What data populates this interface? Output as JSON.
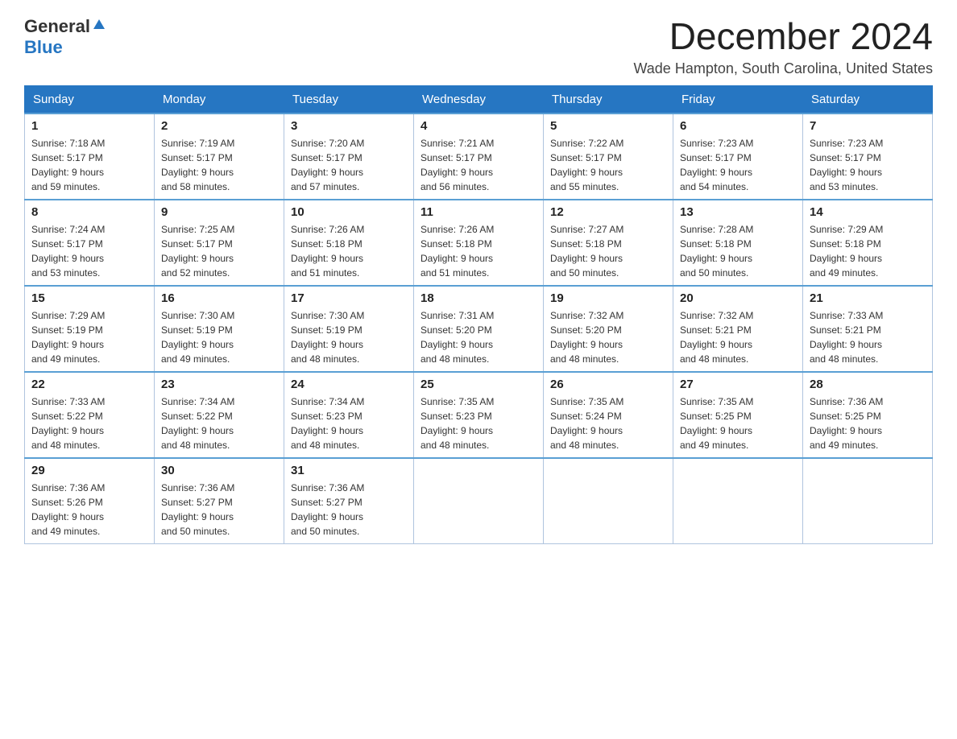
{
  "logo": {
    "general": "General",
    "blue": "Blue"
  },
  "title": "December 2024",
  "subtitle": "Wade Hampton, South Carolina, United States",
  "days_of_week": [
    "Sunday",
    "Monday",
    "Tuesday",
    "Wednesday",
    "Thursday",
    "Friday",
    "Saturday"
  ],
  "weeks": [
    [
      {
        "day": "1",
        "sunrise": "7:18 AM",
        "sunset": "5:17 PM",
        "daylight": "9 hours and 59 minutes."
      },
      {
        "day": "2",
        "sunrise": "7:19 AM",
        "sunset": "5:17 PM",
        "daylight": "9 hours and 58 minutes."
      },
      {
        "day": "3",
        "sunrise": "7:20 AM",
        "sunset": "5:17 PM",
        "daylight": "9 hours and 57 minutes."
      },
      {
        "day": "4",
        "sunrise": "7:21 AM",
        "sunset": "5:17 PM",
        "daylight": "9 hours and 56 minutes."
      },
      {
        "day": "5",
        "sunrise": "7:22 AM",
        "sunset": "5:17 PM",
        "daylight": "9 hours and 55 minutes."
      },
      {
        "day": "6",
        "sunrise": "7:23 AM",
        "sunset": "5:17 PM",
        "daylight": "9 hours and 54 minutes."
      },
      {
        "day": "7",
        "sunrise": "7:23 AM",
        "sunset": "5:17 PM",
        "daylight": "9 hours and 53 minutes."
      }
    ],
    [
      {
        "day": "8",
        "sunrise": "7:24 AM",
        "sunset": "5:17 PM",
        "daylight": "9 hours and 53 minutes."
      },
      {
        "day": "9",
        "sunrise": "7:25 AM",
        "sunset": "5:17 PM",
        "daylight": "9 hours and 52 minutes."
      },
      {
        "day": "10",
        "sunrise": "7:26 AM",
        "sunset": "5:18 PM",
        "daylight": "9 hours and 51 minutes."
      },
      {
        "day": "11",
        "sunrise": "7:26 AM",
        "sunset": "5:18 PM",
        "daylight": "9 hours and 51 minutes."
      },
      {
        "day": "12",
        "sunrise": "7:27 AM",
        "sunset": "5:18 PM",
        "daylight": "9 hours and 50 minutes."
      },
      {
        "day": "13",
        "sunrise": "7:28 AM",
        "sunset": "5:18 PM",
        "daylight": "9 hours and 50 minutes."
      },
      {
        "day": "14",
        "sunrise": "7:29 AM",
        "sunset": "5:18 PM",
        "daylight": "9 hours and 49 minutes."
      }
    ],
    [
      {
        "day": "15",
        "sunrise": "7:29 AM",
        "sunset": "5:19 PM",
        "daylight": "9 hours and 49 minutes."
      },
      {
        "day": "16",
        "sunrise": "7:30 AM",
        "sunset": "5:19 PM",
        "daylight": "9 hours and 49 minutes."
      },
      {
        "day": "17",
        "sunrise": "7:30 AM",
        "sunset": "5:19 PM",
        "daylight": "9 hours and 48 minutes."
      },
      {
        "day": "18",
        "sunrise": "7:31 AM",
        "sunset": "5:20 PM",
        "daylight": "9 hours and 48 minutes."
      },
      {
        "day": "19",
        "sunrise": "7:32 AM",
        "sunset": "5:20 PM",
        "daylight": "9 hours and 48 minutes."
      },
      {
        "day": "20",
        "sunrise": "7:32 AM",
        "sunset": "5:21 PM",
        "daylight": "9 hours and 48 minutes."
      },
      {
        "day": "21",
        "sunrise": "7:33 AM",
        "sunset": "5:21 PM",
        "daylight": "9 hours and 48 minutes."
      }
    ],
    [
      {
        "day": "22",
        "sunrise": "7:33 AM",
        "sunset": "5:22 PM",
        "daylight": "9 hours and 48 minutes."
      },
      {
        "day": "23",
        "sunrise": "7:34 AM",
        "sunset": "5:22 PM",
        "daylight": "9 hours and 48 minutes."
      },
      {
        "day": "24",
        "sunrise": "7:34 AM",
        "sunset": "5:23 PM",
        "daylight": "9 hours and 48 minutes."
      },
      {
        "day": "25",
        "sunrise": "7:35 AM",
        "sunset": "5:23 PM",
        "daylight": "9 hours and 48 minutes."
      },
      {
        "day": "26",
        "sunrise": "7:35 AM",
        "sunset": "5:24 PM",
        "daylight": "9 hours and 48 minutes."
      },
      {
        "day": "27",
        "sunrise": "7:35 AM",
        "sunset": "5:25 PM",
        "daylight": "9 hours and 49 minutes."
      },
      {
        "day": "28",
        "sunrise": "7:36 AM",
        "sunset": "5:25 PM",
        "daylight": "9 hours and 49 minutes."
      }
    ],
    [
      {
        "day": "29",
        "sunrise": "7:36 AM",
        "sunset": "5:26 PM",
        "daylight": "9 hours and 49 minutes."
      },
      {
        "day": "30",
        "sunrise": "7:36 AM",
        "sunset": "5:27 PM",
        "daylight": "9 hours and 50 minutes."
      },
      {
        "day": "31",
        "sunrise": "7:36 AM",
        "sunset": "5:27 PM",
        "daylight": "9 hours and 50 minutes."
      },
      null,
      null,
      null,
      null
    ]
  ],
  "labels": {
    "sunrise": "Sunrise:",
    "sunset": "Sunset:",
    "daylight": "Daylight:"
  }
}
